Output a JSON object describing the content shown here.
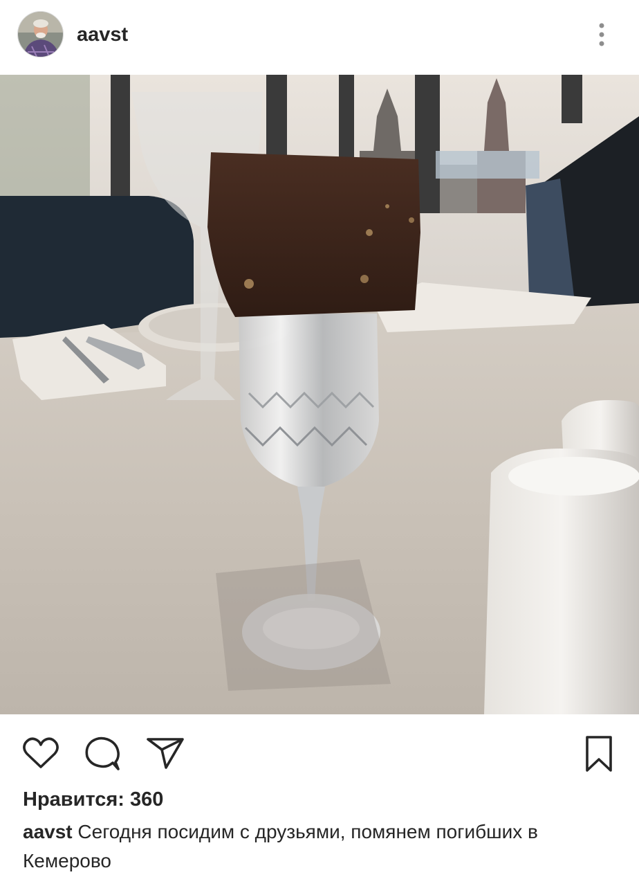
{
  "post": {
    "username": "aavst",
    "likes_text": "Нравится: 360",
    "caption_user": "aavst",
    "caption_text": "Сегодня посидим с друзьями, помянем погибших в Кемерово"
  },
  "icons": {
    "more": "more-vertical-icon",
    "like": "heart-icon",
    "comment": "comment-icon",
    "share": "send-icon",
    "save": "bookmark-icon"
  },
  "colors": {
    "text": "#262626",
    "background": "#ffffff"
  }
}
